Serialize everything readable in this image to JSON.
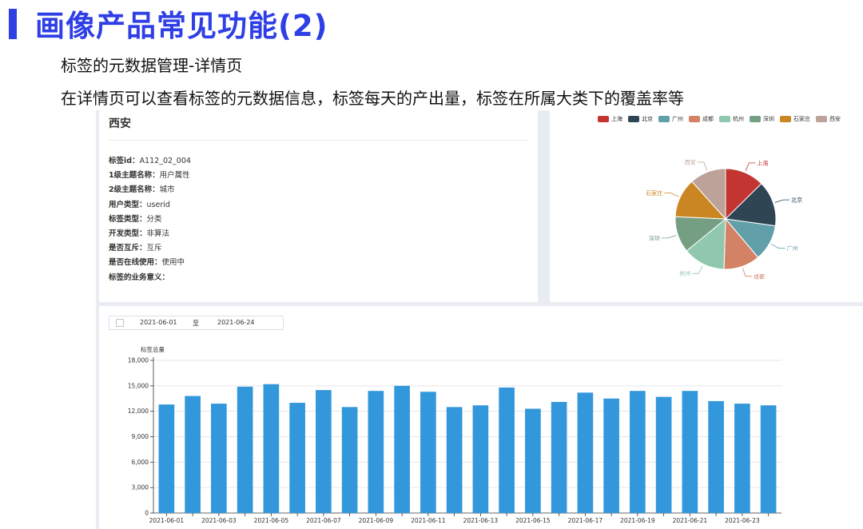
{
  "slide": {
    "title": "画像产品常见功能(2)",
    "subtitle1": "标签的元数据管理-详情页",
    "subtitle2": "在详情页可以查看标签的元数据信息，标签每天的产出量，标签在所属大类下的覆盖率等"
  },
  "detail": {
    "title": "西安",
    "fields": [
      {
        "k": "标签id：",
        "v": "A112_02_004"
      },
      {
        "k": "1级主题名称：",
        "v": "用户属性"
      },
      {
        "k": "2级主题名称：",
        "v": "城市"
      },
      {
        "k": "用户类型：",
        "v": "userid"
      },
      {
        "k": "标签类型：",
        "v": "分类"
      },
      {
        "k": "开发类型：",
        "v": "非算法"
      },
      {
        "k": "是否互斥：",
        "v": "互斥"
      },
      {
        "k": "是否在线使用：",
        "v": "使用中"
      },
      {
        "k": "标签的业务意义：",
        "v": ""
      }
    ]
  },
  "date_range": {
    "start": "2021-06-01",
    "sep": "至",
    "end": "2021-06-24"
  },
  "chart_data": [
    {
      "type": "pie",
      "categories": [
        "上海",
        "北京",
        "广州",
        "成都",
        "杭州",
        "深圳",
        "石家庄",
        "西安"
      ],
      "values": [
        13,
        15,
        12,
        12,
        14,
        12,
        13,
        12
      ],
      "colors": [
        "#c23531",
        "#2f4554",
        "#61a0a8",
        "#d48265",
        "#91c7ae",
        "#749f83",
        "#ca8622",
        "#bda29a"
      ],
      "legend": "top",
      "title": ""
    },
    {
      "type": "bar",
      "title": "",
      "ylabel": "标签总量",
      "ylim": [
        0,
        18000
      ],
      "yticks": [
        0,
        3000,
        6000,
        9000,
        12000,
        15000,
        18000
      ],
      "yticklabels": [
        "0",
        "3,000",
        "6,000",
        "9,000",
        "12,000",
        "15,000",
        "18,000"
      ],
      "categories": [
        "2021-06-01",
        "2021-06-02",
        "2021-06-03",
        "2021-06-04",
        "2021-06-05",
        "2021-06-06",
        "2021-06-07",
        "2021-06-08",
        "2021-06-09",
        "2021-06-10",
        "2021-06-11",
        "2021-06-12",
        "2021-06-13",
        "2021-06-14",
        "2021-06-15",
        "2021-06-16",
        "2021-06-17",
        "2021-06-18",
        "2021-06-19",
        "2021-06-20",
        "2021-06-21",
        "2021-06-22",
        "2021-06-23",
        "2021-06-24"
      ],
      "xticklabels_shown": [
        "2021-06-01",
        "2021-06-03",
        "2021-06-05",
        "2021-06-07",
        "2021-06-09",
        "2021-06-11",
        "2021-06-13",
        "2021-06-15",
        "2021-06-17",
        "2021-06-19",
        "2021-06-21",
        "2021-06-23"
      ],
      "values": [
        12800,
        13800,
        12900,
        14900,
        15200,
        13000,
        14500,
        12500,
        14400,
        15000,
        14300,
        12500,
        12700,
        14800,
        12300,
        13100,
        14200,
        13500,
        14400,
        13700,
        14400,
        13200,
        12900,
        12700
      ],
      "color": "#3398db",
      "grid": true
    }
  ]
}
